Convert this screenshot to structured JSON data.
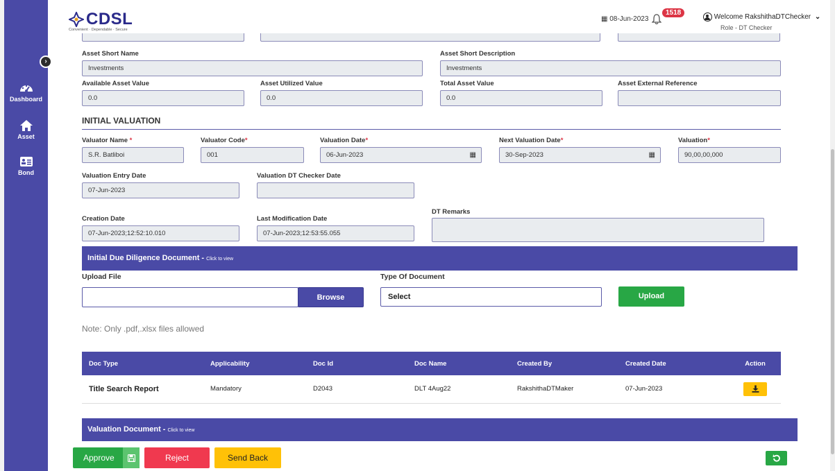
{
  "sidebar": {
    "items": [
      {
        "label": "Dashboard",
        "icon": "dashboard-icon"
      },
      {
        "label": "Asset",
        "icon": "home-icon"
      },
      {
        "label": "Bond",
        "icon": "id-card-icon"
      }
    ]
  },
  "header": {
    "brand": "CDSL",
    "tagline": "Convenient · Dependable · Secure",
    "date": "08-Jun-2023",
    "notifications": "1518",
    "welcome": "Welcome RakshithaDTChecker",
    "role": "Role - DT Checker"
  },
  "asset": {
    "short_name_label": "Asset Short Name",
    "short_name": "Investments",
    "short_desc_label": "Asset Short Description",
    "short_desc": "Investments",
    "available_label": "Available Asset Value",
    "available": "0.0",
    "utilized_label": "Asset Utilized Value",
    "utilized": "0.0",
    "total_label": "Total Asset Value",
    "total": "0.0",
    "ext_ref_label": "Asset External Reference",
    "ext_ref": ""
  },
  "valuation": {
    "title": "INITIAL VALUATION",
    "valuator_name_label": "Valuator Name",
    "valuator_name": "S.R. Batliboi",
    "valuator_code_label": "Valuator Code",
    "valuator_code": "001",
    "valuation_date_label": "Valuation Date",
    "valuation_date": "06-Jun-2023",
    "next_date_label": "Next Valuation Date",
    "next_date": "30-Sep-2023",
    "valuation_label": "Valuation",
    "valuation": "90,00,00,000",
    "entry_date_label": "Valuation Entry Date",
    "entry_date": "07-Jun-2023",
    "checker_date_label": "Valuation DT Checker Date",
    "checker_date": "",
    "creation_label": "Creation Date",
    "creation": "07-Jun-2023;12:52:10.010",
    "modification_label": "Last Modification Date",
    "modification": "07-Jun-2023;12:53:55.055",
    "remarks_label": "DT Remarks",
    "remarks": ""
  },
  "due_diligence": {
    "title": "Initial Due Diligence Document - ",
    "click": "Click to view",
    "upload_label": "Upload File",
    "browse": "Browse",
    "type_label": "Type Of Document",
    "type_value": "Select",
    "upload_btn": "Upload",
    "note": "Note: Only .pdf,.xlsx files allowed",
    "columns": [
      "Doc Type",
      "Applicability",
      "Doc Id",
      "Doc Name",
      "Created By",
      "Created Date",
      "Action"
    ],
    "rows": [
      {
        "doc_type": "Title Search Report",
        "applicability": "Mandatory",
        "doc_id": "D2043",
        "doc_name": "DLT 4Aug22",
        "created_by": "RakshithaDTMaker",
        "created_date": "07-Jun-2023"
      }
    ]
  },
  "valuation_doc": {
    "title": "Valuation Document - ",
    "click": "Click to view"
  },
  "actions": {
    "approve": "Approve",
    "reject": "Reject",
    "send_back": "Send Back"
  },
  "colors": {
    "primary": "#4a4aa6",
    "approve": "#28a745",
    "reject": "#f0394f",
    "send_back": "#ffc107"
  }
}
